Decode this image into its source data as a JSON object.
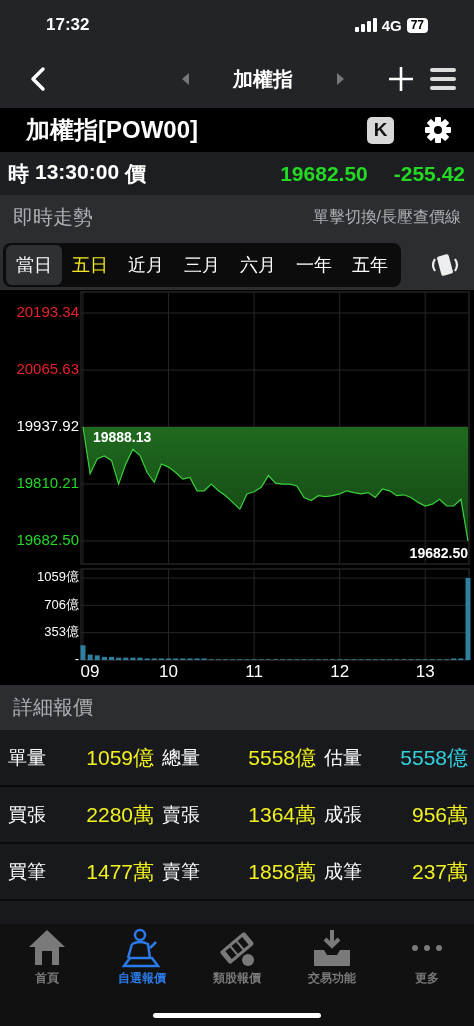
{
  "status_bar": {
    "time": "17:32",
    "network": "4G",
    "battery": "77"
  },
  "nav": {
    "title": "加權指"
  },
  "header": {
    "title": "加權指[POW00]",
    "k_button": "K"
  },
  "quote": {
    "time_label": "時",
    "time": "13:30:00",
    "price_label": "價",
    "price": "19682.50",
    "change": "-255.42",
    "color": "#23d923"
  },
  "trend_section": {
    "title": "即時走勢",
    "hint": "單擊切換/長壓查價線"
  },
  "periods": [
    {
      "label": "當日",
      "selected": true,
      "highlighted": false
    },
    {
      "label": "五日",
      "selected": false,
      "highlighted": true
    },
    {
      "label": "近月",
      "selected": false,
      "highlighted": false
    },
    {
      "label": "三月",
      "selected": false,
      "highlighted": false
    },
    {
      "label": "六月",
      "selected": false,
      "highlighted": false
    },
    {
      "label": "一年",
      "selected": false,
      "highlighted": false
    },
    {
      "label": "五年",
      "selected": false,
      "highlighted": false
    }
  ],
  "price_chart": {
    "chart_data": {
      "type": "line",
      "grid": true,
      "categories": [
        null,
        null,
        null,
        null,
        null,
        null,
        null,
        null,
        null,
        null,
        null,
        null,
        null,
        null,
        null,
        null,
        null,
        null,
        null,
        null,
        null,
        null,
        null,
        null,
        null,
        null,
        null,
        null,
        null,
        null,
        null,
        null,
        null,
        null,
        null,
        null,
        null,
        null,
        null,
        null,
        null,
        null,
        null,
        null,
        null,
        null,
        null,
        null,
        null,
        null,
        null,
        null,
        null,
        null,
        null
      ],
      "series": [
        {
          "color": "#3bd13b",
          "values": [
            19937.92,
            19833,
            19867,
            19873,
            19863,
            19810,
            19855,
            19888,
            19874,
            19836,
            19814,
            19855,
            19848,
            19836,
            19821,
            19825,
            19795,
            19795,
            19810,
            19795,
            19784,
            19769,
            19754,
            19788,
            19793,
            19803,
            19829,
            19812,
            19810,
            19810,
            19806,
            19780,
            19773,
            19784,
            19782,
            19784,
            19788,
            19795,
            19791,
            19788,
            19791,
            19780,
            19799,
            19795,
            19784,
            19786,
            19780,
            19769,
            19761,
            19765,
            19776,
            19761,
            19761,
            19776,
            19683
          ]
        }
      ],
      "ylim": [
        19682.5,
        20193.34
      ],
      "yticks": [
        {
          "value": 20193.34,
          "label": "20193.34"
        },
        {
          "value": 20065.63,
          "label": "20065.63"
        },
        {
          "value": 19937.92,
          "label": "19937.92"
        },
        {
          "value": 19810.21,
          "label": "19810.21"
        },
        {
          "value": 19682.5,
          "label": "19682.50"
        }
      ],
      "annotations": [
        {
          "text": "19888.13"
        },
        {
          "text": "19682.50"
        }
      ]
    }
  },
  "volume_chart": {
    "chart_data": {
      "type": "bar",
      "grid": true,
      "categories": [
        "09",
        null,
        null,
        null,
        null,
        null,
        null,
        null,
        null,
        null,
        null,
        null,
        "10",
        null,
        null,
        null,
        null,
        null,
        null,
        null,
        null,
        null,
        null,
        null,
        "11",
        null,
        null,
        null,
        null,
        null,
        null,
        null,
        null,
        null,
        null,
        null,
        "12",
        null,
        null,
        null,
        null,
        null,
        null,
        null,
        null,
        null,
        null,
        null,
        "13",
        null,
        null,
        null,
        null,
        null,
        null
      ],
      "series": [
        {
          "color": "#2f7f9f",
          "values": [
            190,
            70,
            60,
            40,
            40,
            30,
            30,
            30,
            30,
            20,
            20,
            20,
            20,
            20,
            20,
            20,
            20,
            20,
            10,
            10,
            10,
            10,
            10,
            10,
            10,
            10,
            10,
            10,
            10,
            10,
            10,
            10,
            10,
            10,
            10,
            10,
            10,
            10,
            10,
            10,
            10,
            10,
            10,
            10,
            10,
            10,
            10,
            10,
            10,
            10,
            10,
            10,
            20,
            20,
            1059
          ]
        }
      ],
      "ylim": [
        0,
        1059
      ],
      "yticks": [
        {
          "value": 0,
          "label": "-"
        },
        {
          "value": 353,
          "label": "353億"
        },
        {
          "value": 706,
          "label": "706億"
        },
        {
          "value": 1059,
          "label": "1059億"
        }
      ]
    }
  },
  "detail_section": {
    "title": "詳細報價"
  },
  "stats": [
    [
      {
        "label": "單量",
        "value": "1059億",
        "color": "#f2f21f"
      },
      {
        "label": "總量",
        "value": "5558億",
        "color": "#f2f21f"
      },
      {
        "label": "估量",
        "value": "5558億",
        "color": "#33d1dc"
      }
    ],
    [
      {
        "label": "買張",
        "value": "2280萬",
        "color": "#f2f21f"
      },
      {
        "label": "賣張",
        "value": "1364萬",
        "color": "#f2f21f"
      },
      {
        "label": "成張",
        "value": "956萬",
        "color": "#f2f21f"
      }
    ],
    [
      {
        "label": "買筆",
        "value": "1477萬",
        "color": "#f2f21f"
      },
      {
        "label": "賣筆",
        "value": "1858萬",
        "color": "#f2f21f"
      },
      {
        "label": "成筆",
        "value": "237萬",
        "color": "#f2f21f"
      }
    ]
  ],
  "tab_bar": [
    {
      "kind": "home",
      "label": "首頁",
      "selected": false
    },
    {
      "kind": "watchlist",
      "label": "自選報價",
      "selected": true
    },
    {
      "kind": "sector",
      "label": "類股報價",
      "selected": false
    },
    {
      "kind": "trade",
      "label": "交易功能",
      "selected": false
    },
    {
      "kind": "more",
      "label": "更多",
      "selected": false
    }
  ]
}
